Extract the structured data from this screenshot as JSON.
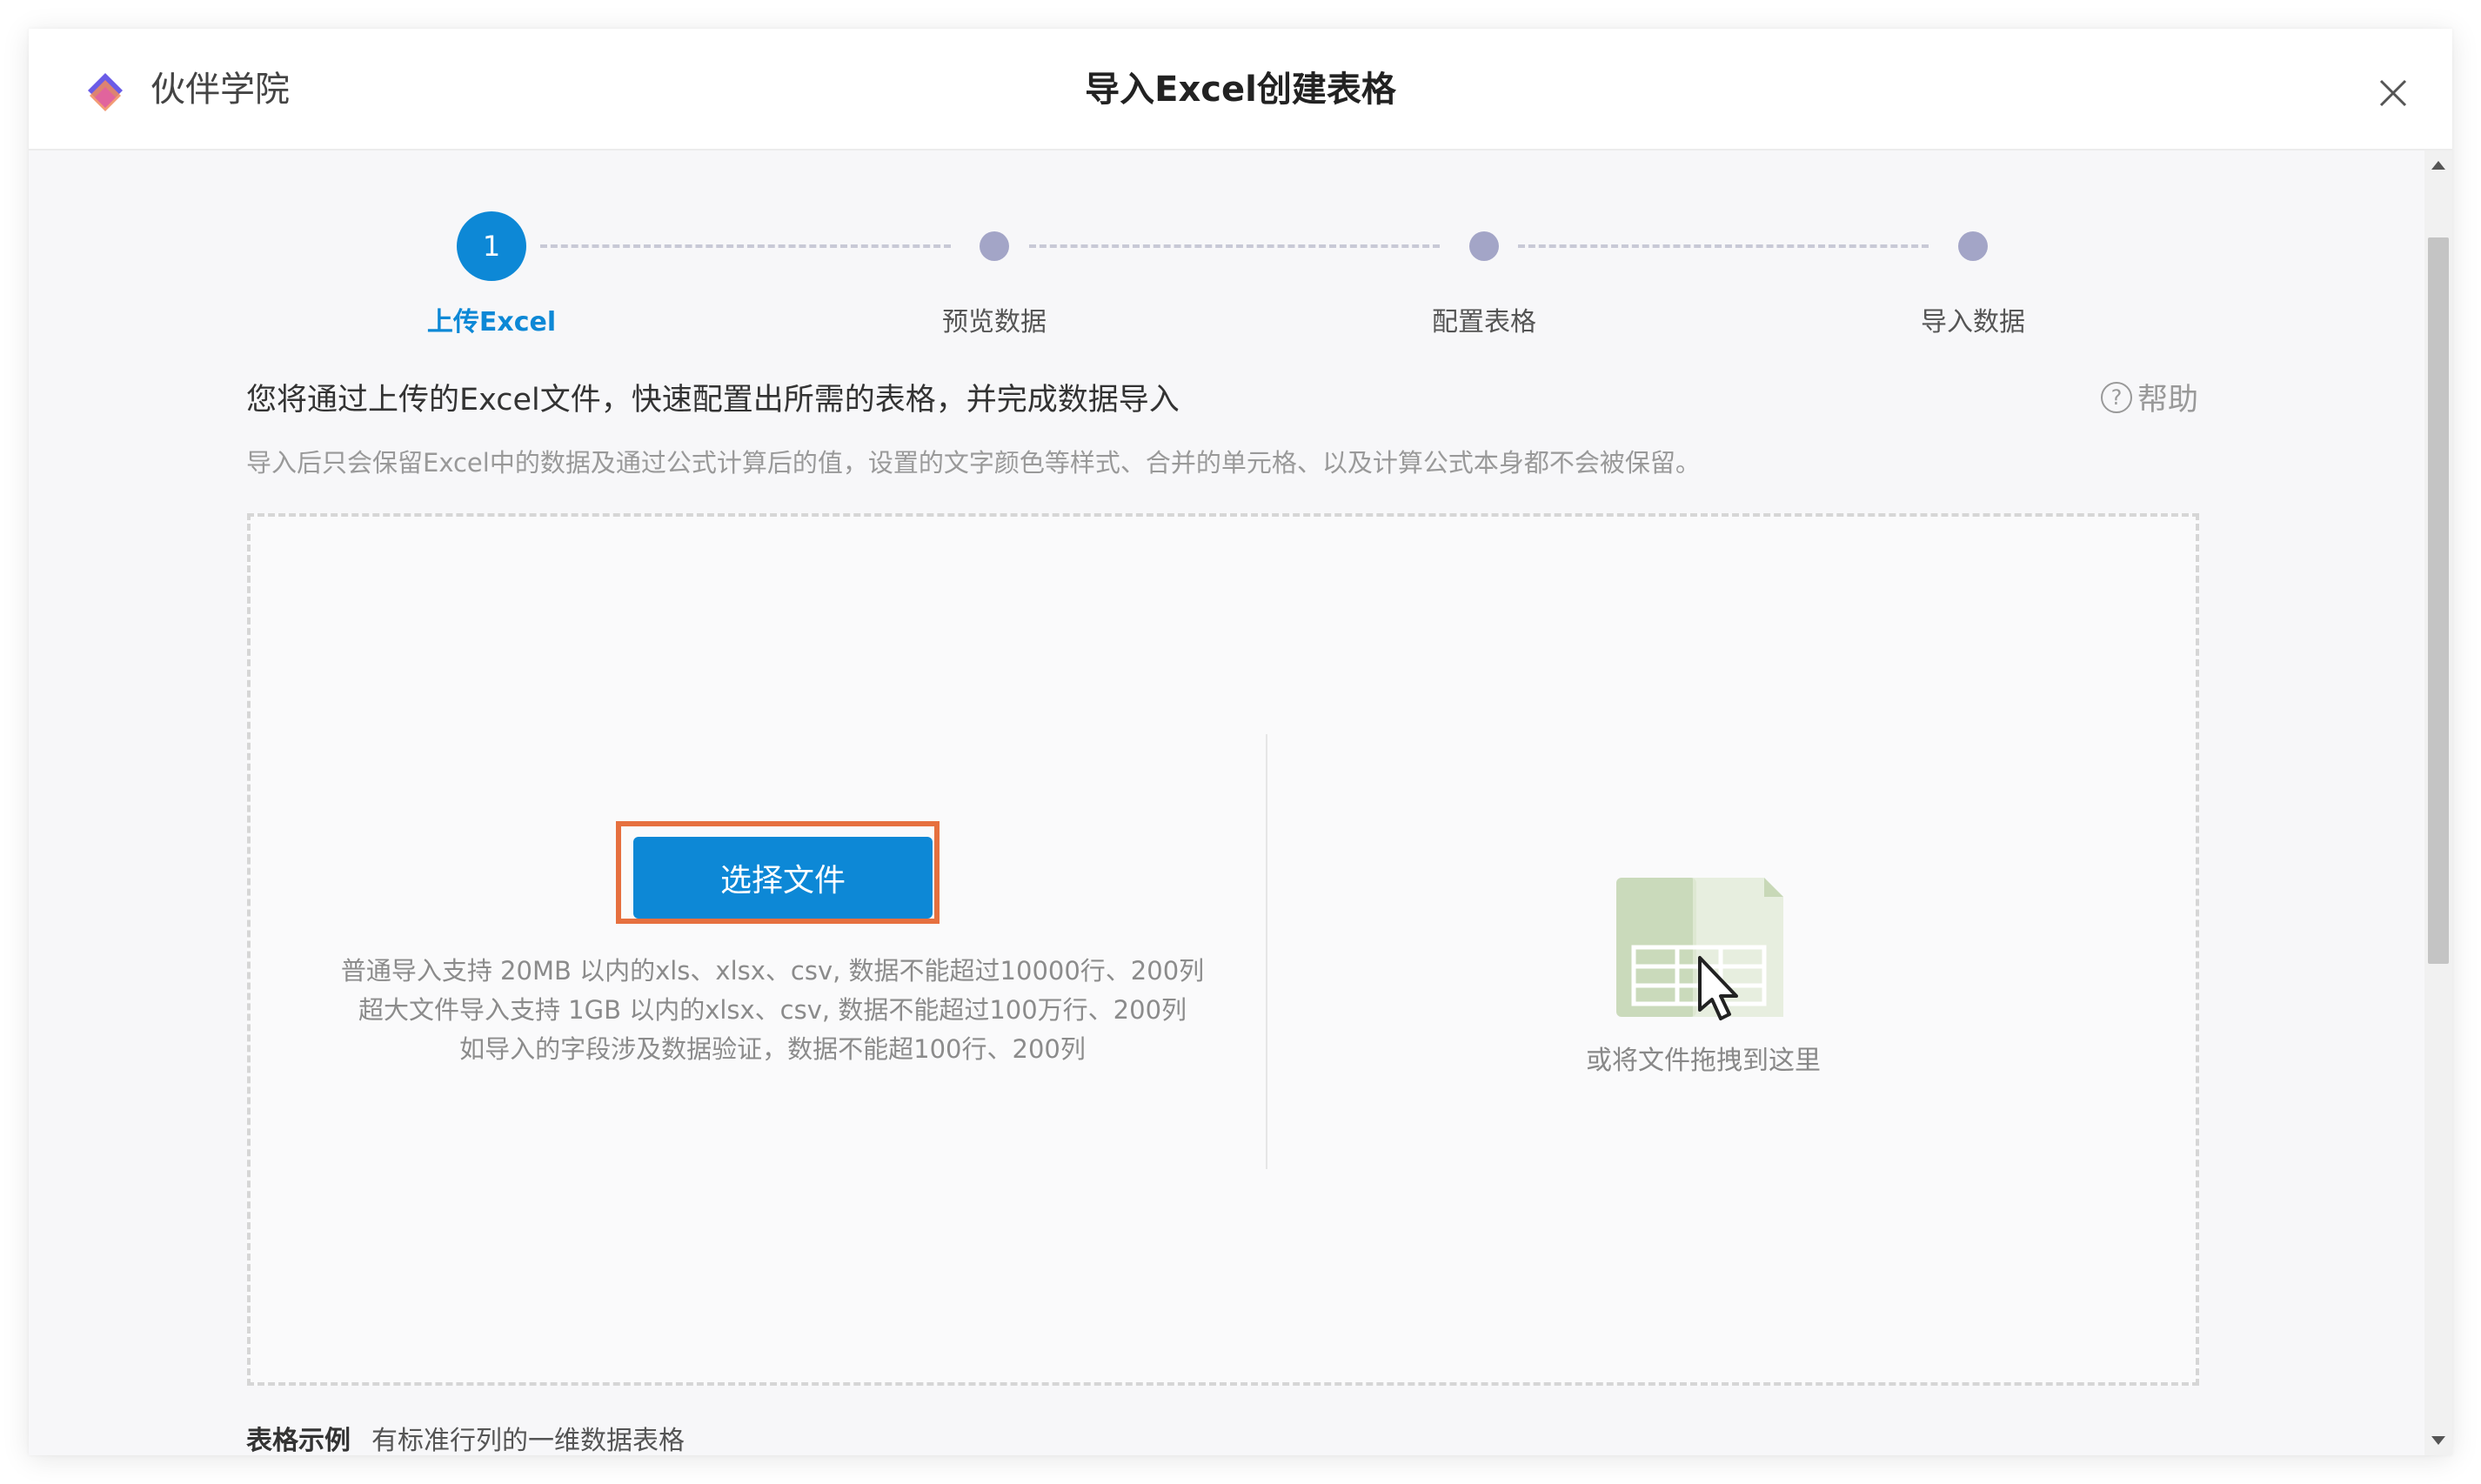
{
  "header": {
    "brand": "伙伴学院",
    "title": "导入Excel创建表格"
  },
  "steps": [
    {
      "number": "1",
      "label": "上传Excel",
      "active": true
    },
    {
      "number": "",
      "label": "预览数据",
      "active": false
    },
    {
      "number": "",
      "label": "配置表格",
      "active": false
    },
    {
      "number": "",
      "label": "导入数据",
      "active": false
    }
  ],
  "intro": "您将通过上传的Excel文件，快速配置出所需的表格，并完成数据导入",
  "help_label": "帮助",
  "note": "导入后只会保留Excel中的数据及通过公式计算后的值，设置的文字颜色等样式、合并的单元格、以及计算公式本身都不会被保留。",
  "upload": {
    "button_label": "选择文件",
    "limits": [
      "普通导入支持 20MB 以内的xls、xlsx、csv, 数据不能超过10000行、200列",
      "超大文件导入支持 1GB 以内的xlsx、csv, 数据不能超过100万行、200列",
      "如导入的字段涉及数据验证，数据不能超100行、200列"
    ],
    "drop_text": "或将文件拖拽到这里"
  },
  "example": {
    "title": "表格示例",
    "text": "有标准行列的一维数据表格"
  },
  "colors": {
    "accent": "#0d88d6",
    "highlight_border": "#e6703f",
    "inactive_step": "#a3a5c7"
  }
}
